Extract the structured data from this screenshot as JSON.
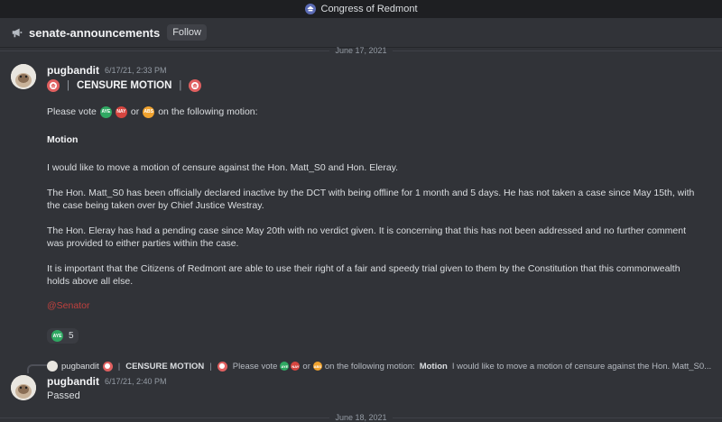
{
  "window": {
    "title": "Congress of Redmont"
  },
  "channel": {
    "name": "senate-announcements",
    "follow_label": "Follow"
  },
  "date_dividers": [
    "June 17, 2021",
    "June 18, 2021"
  ],
  "reaction_labels": {
    "aye": "AYE",
    "nay": "NAY",
    "abs": "ABS"
  },
  "message1": {
    "author": "pugbandit",
    "timestamp": "6/17/21, 2:33 PM",
    "title_sep": "|",
    "title": "CENSURE MOTION",
    "vote_prefix": "Please vote",
    "vote_or": "or",
    "vote_suffix": "on the following motion:",
    "heading": "Motion",
    "p1": "I would like to move a motion of censure against the Hon. Matt_S0 and Hon. Eleray.",
    "p2": "The Hon. Matt_S0 has been officially declared inactive by the DCT with being offline for 1 month and 5 days. He has not taken a case since May 15th, with the case being taken over by Chief Justice Westray.",
    "p3": "The Hon. Eleray has had a pending case since May 20th with no verdict given. It is concerning that this has not been addressed and no further comment was provided to either parties within the case.",
    "p4": "It is important that the Citizens of Redmont are able to use their right of a fair and speedy trial given to them by the Constitution that this commonwealth holds above all else.",
    "mention": "@Senator",
    "reaction_count": "5"
  },
  "reply_preview": {
    "author": "pugbandit",
    "sep": "|",
    "title": "CENSURE MOTION",
    "vote_prefix": "Please vote",
    "vote_or": "or",
    "vote_suffix": "on the following motion:",
    "heading": "Motion",
    "snippet": "I would like to move a motion of censure against the Hon. Matt_S0..."
  },
  "message2": {
    "author": "pugbandit",
    "timestamp": "6/17/21, 2:40 PM",
    "text": "Passed"
  },
  "colors": {
    "background": "#313338",
    "titlebar": "#1e1f22",
    "mention": "#c0413e",
    "aye": "#2fa862",
    "nay": "#d6453f",
    "abs": "#f0a22e"
  }
}
